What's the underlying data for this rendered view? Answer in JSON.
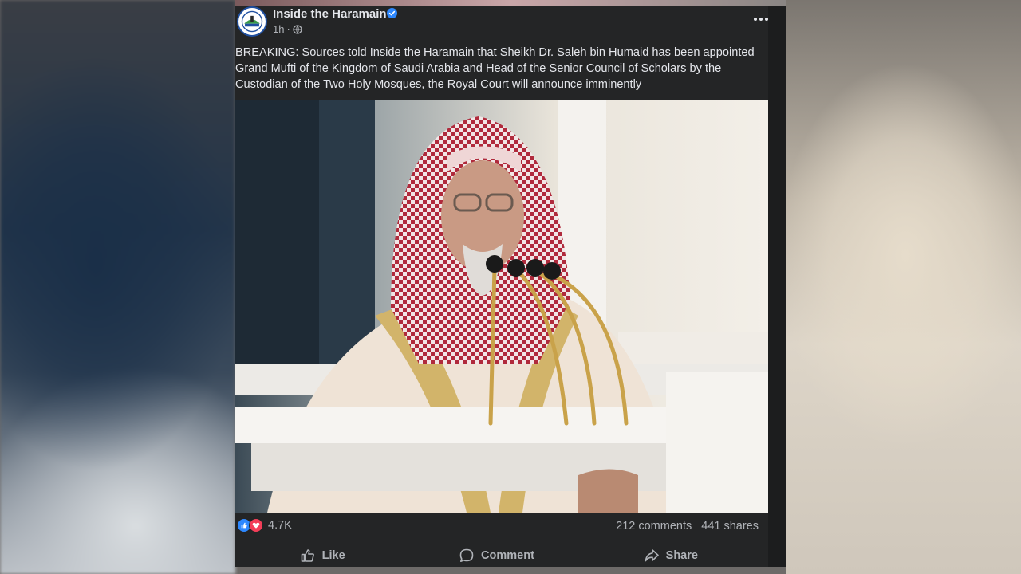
{
  "post": {
    "page_name": "Inside the Haramain",
    "verified": true,
    "time": "1h",
    "separator": "·",
    "audience_icon": "globe-icon",
    "text": "BREAKING: Sources told Inside the Haramain that Sheikh Dr. Saleh bin Humaid has been appointed Grand Mufti of the Kingdom of Saudi Arabia and Head of the Senior Council of Scholars by the Custodian of the Two Holy Mosques, the Royal Court will announce imminently"
  },
  "stats": {
    "reactions": [
      "like",
      "love"
    ],
    "reaction_count": "4.7K",
    "comments": "212 comments",
    "shares": "441 shares"
  },
  "actions": {
    "like_label": "Like",
    "comment_label": "Comment",
    "share_label": "Share"
  },
  "colors": {
    "card_bg": "#242526",
    "text_primary": "#e4e6eb",
    "text_secondary": "#b0b3b8",
    "like_blue": "#2d88ff",
    "love_red": "#f33e58",
    "verified_blue": "#2d88ff"
  }
}
